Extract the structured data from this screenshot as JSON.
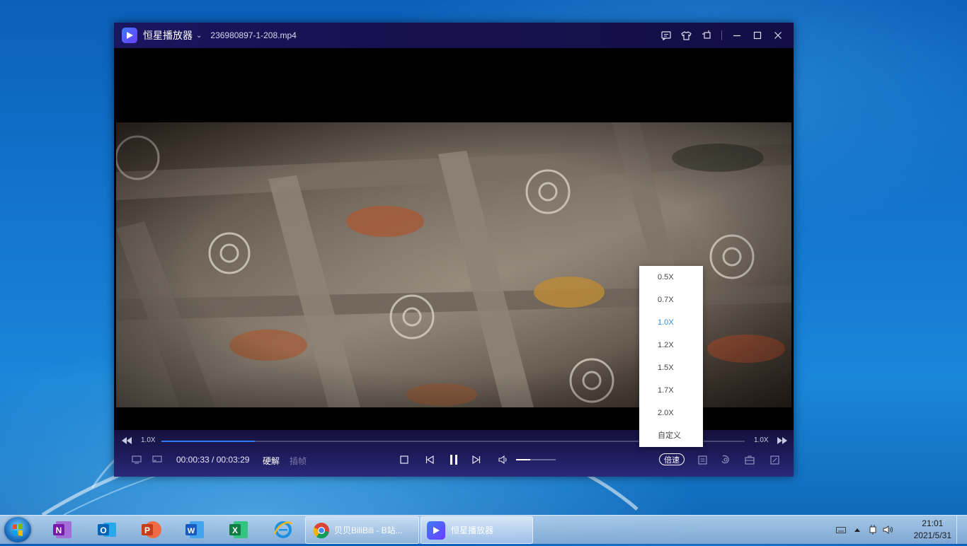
{
  "player": {
    "app_name": "恒星播放器",
    "file_name": "236980897-1-208.mp4",
    "controls": {
      "speed_left": "1.0X",
      "speed_right": "1.0X",
      "progress": 0.16,
      "time": "00:00:33 / 00:03:29",
      "hw_decode": "硬解",
      "frame_interp": "插帧",
      "volume": 0.35,
      "speed_button": "倍速"
    },
    "speed_menu": {
      "items": [
        "0.5X",
        "0.7X",
        "1.0X",
        "1.2X",
        "1.5X",
        "1.7X",
        "2.0X",
        "自定义"
      ],
      "selected": "1.0X"
    }
  },
  "taskbar": {
    "tasks": [
      {
        "label": "贝贝BiliBili - B站..."
      },
      {
        "label": "恒星播放器"
      }
    ],
    "clock": {
      "time": "21:01",
      "date": "2021/5/31"
    }
  }
}
